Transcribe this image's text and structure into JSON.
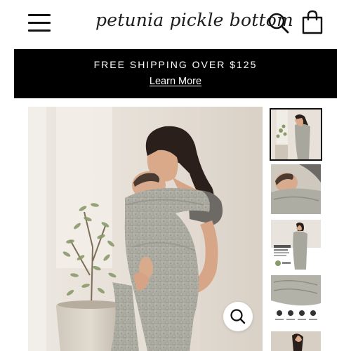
{
  "header": {
    "brand": "petunia pickle bottom",
    "menu_icon": "hamburger-menu-icon",
    "search_icon": "search-icon",
    "cart_icon": "shopping-bag-icon"
  },
  "promo": {
    "text": "FREE SHIPPING OVER $125",
    "link": "Learn More",
    "background": "#000000",
    "color": "#ffffff"
  },
  "product": {
    "main_image": "Woman wearing grey patterned baby wrap carrier holding baby, olive tree in pot beside her",
    "zoom_icon": "zoom-magnifier-icon",
    "thumbnails": [
      {
        "label": "Woman in wrap carrier with olive tree",
        "active": true
      },
      {
        "label": "Close-up of baby in wrap",
        "active": false
      },
      {
        "label": "Infographic with model in wrap",
        "active": false,
        "text": "HEALTHY SUPPORT"
      },
      {
        "label": "Folded wrap with feature icons",
        "active": false
      },
      {
        "label": "Partial thumbnail",
        "active": false
      }
    ]
  },
  "colors": {
    "accent": "#111111",
    "image_bg": "#e9e4dd"
  }
}
